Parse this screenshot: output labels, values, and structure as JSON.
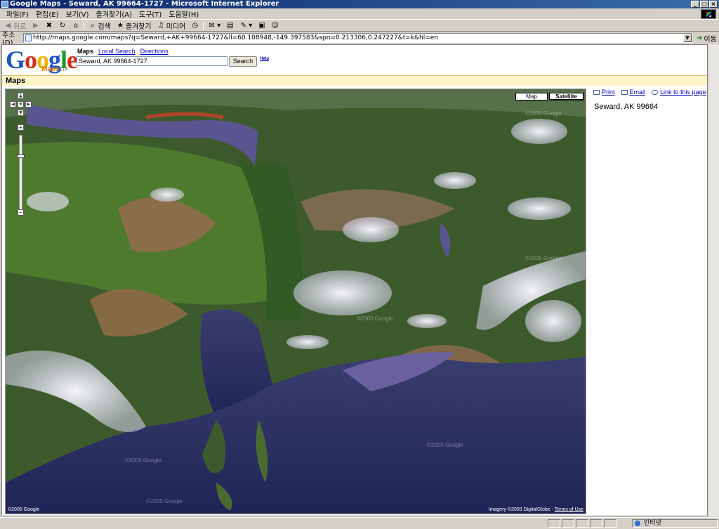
{
  "window": {
    "title": "Google Maps - Seward, AK 99664-1727 - Microsoft Internet Explorer"
  },
  "menu": [
    "파일(F)",
    "편집(E)",
    "보기(V)",
    "즐겨찾기(A)",
    "도구(T)",
    "도움말(H)"
  ],
  "toolbar": {
    "back": "뒤로",
    "search": "검색",
    "favorites": "즐겨찾기",
    "media": "미디어"
  },
  "address_bar": {
    "label": "주소(D)",
    "url": "http://maps.google.com/maps?q=Seward,+AK+99664-1727&ll=60.108948,-149.397583&spn=0.213306,0.247227&t=k&hl=en",
    "go": "이동"
  },
  "google": {
    "logo_text": "Google",
    "logo_sub": "Maps",
    "logo_beta": "BETA",
    "tabs": {
      "maps": "Maps",
      "local": "Local Search",
      "directions": "Directions"
    },
    "search_value": "Seward, AK 99664-1727",
    "search_button": "Search",
    "help": "Help"
  },
  "band_title": "Maps",
  "map": {
    "type_map": "Map",
    "type_satellite": "Satellite",
    "copyright_left": "©2005 Google",
    "imagery": "Imagery ©2005 DigitalGlobe - ",
    "terms": "Terms of Use",
    "watermark": "©2005 Google",
    "zoom_level": 0.26
  },
  "panel": {
    "print": "Print",
    "email": "Email",
    "link": "Link to this page",
    "address": "Seward, AK 99664"
  },
  "status": {
    "zone": "인터넷"
  },
  "colors": {
    "band": "#fff3c8",
    "link": "#0000cc",
    "title_bar": "#0a246a"
  }
}
